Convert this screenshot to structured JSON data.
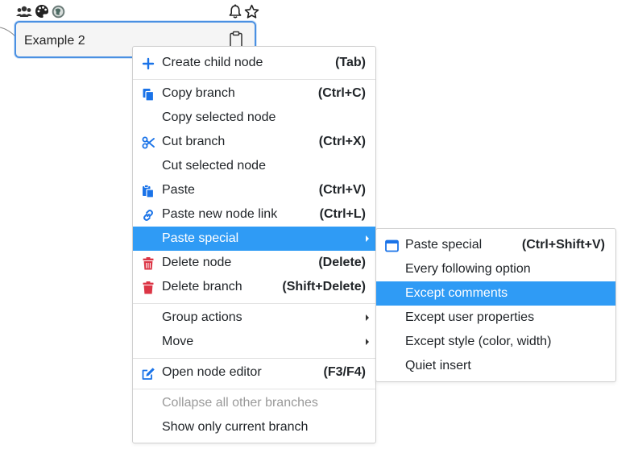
{
  "node": {
    "title": "Example 2"
  },
  "colors": {
    "accent_blue": "#1a73e8",
    "delete_red": "#dc3545",
    "highlight": "#2f9bf5",
    "node_border": "#4a90e2"
  },
  "node_toolbar": {
    "left_icons": [
      "users-icon",
      "palette-icon",
      "globe-icon"
    ],
    "right_icons": [
      "bell-icon",
      "star-icon"
    ]
  },
  "context_menu": {
    "create_child": {
      "label": "Create child node",
      "shortcut": "(Tab)",
      "icon": "plus-icon"
    },
    "copy_branch": {
      "label": "Copy branch",
      "shortcut": "(Ctrl+C)",
      "icon": "copy-icon"
    },
    "copy_selected": {
      "label": "Copy selected node"
    },
    "cut_branch": {
      "label": "Cut branch",
      "shortcut": "(Ctrl+X)",
      "icon": "scissors-icon"
    },
    "cut_selected": {
      "label": "Cut selected node"
    },
    "paste": {
      "label": "Paste",
      "shortcut": "(Ctrl+V)",
      "icon": "paste-icon"
    },
    "paste_link": {
      "label": "Paste new node link",
      "shortcut": "(Ctrl+L)",
      "icon": "link-icon"
    },
    "paste_special": {
      "label": "Paste special"
    },
    "delete_node": {
      "label": "Delete node",
      "shortcut": "(Delete)",
      "icon": "trash-icon"
    },
    "delete_branch": {
      "label": "Delete branch",
      "shortcut": "(Shift+Delete)",
      "icon": "trash-icon"
    },
    "group_actions": {
      "label": "Group actions"
    },
    "move": {
      "label": "Move"
    },
    "open_editor": {
      "label": "Open node editor",
      "shortcut": "(F3/F4)",
      "icon": "edit-icon"
    },
    "collapse_others": {
      "label": "Collapse all other branches"
    },
    "show_only_current": {
      "label": "Show only current branch"
    }
  },
  "paste_special_submenu": {
    "paste_special": {
      "label": "Paste special",
      "shortcut": "(Ctrl+Shift+V)",
      "icon": "window-icon"
    },
    "every_following": {
      "label": "Every following option"
    },
    "except_comments": {
      "label": "Except comments"
    },
    "except_user_props": {
      "label": "Except user properties"
    },
    "except_style": {
      "label": "Except style (color, width)"
    },
    "quiet_insert": {
      "label": "Quiet insert"
    }
  }
}
